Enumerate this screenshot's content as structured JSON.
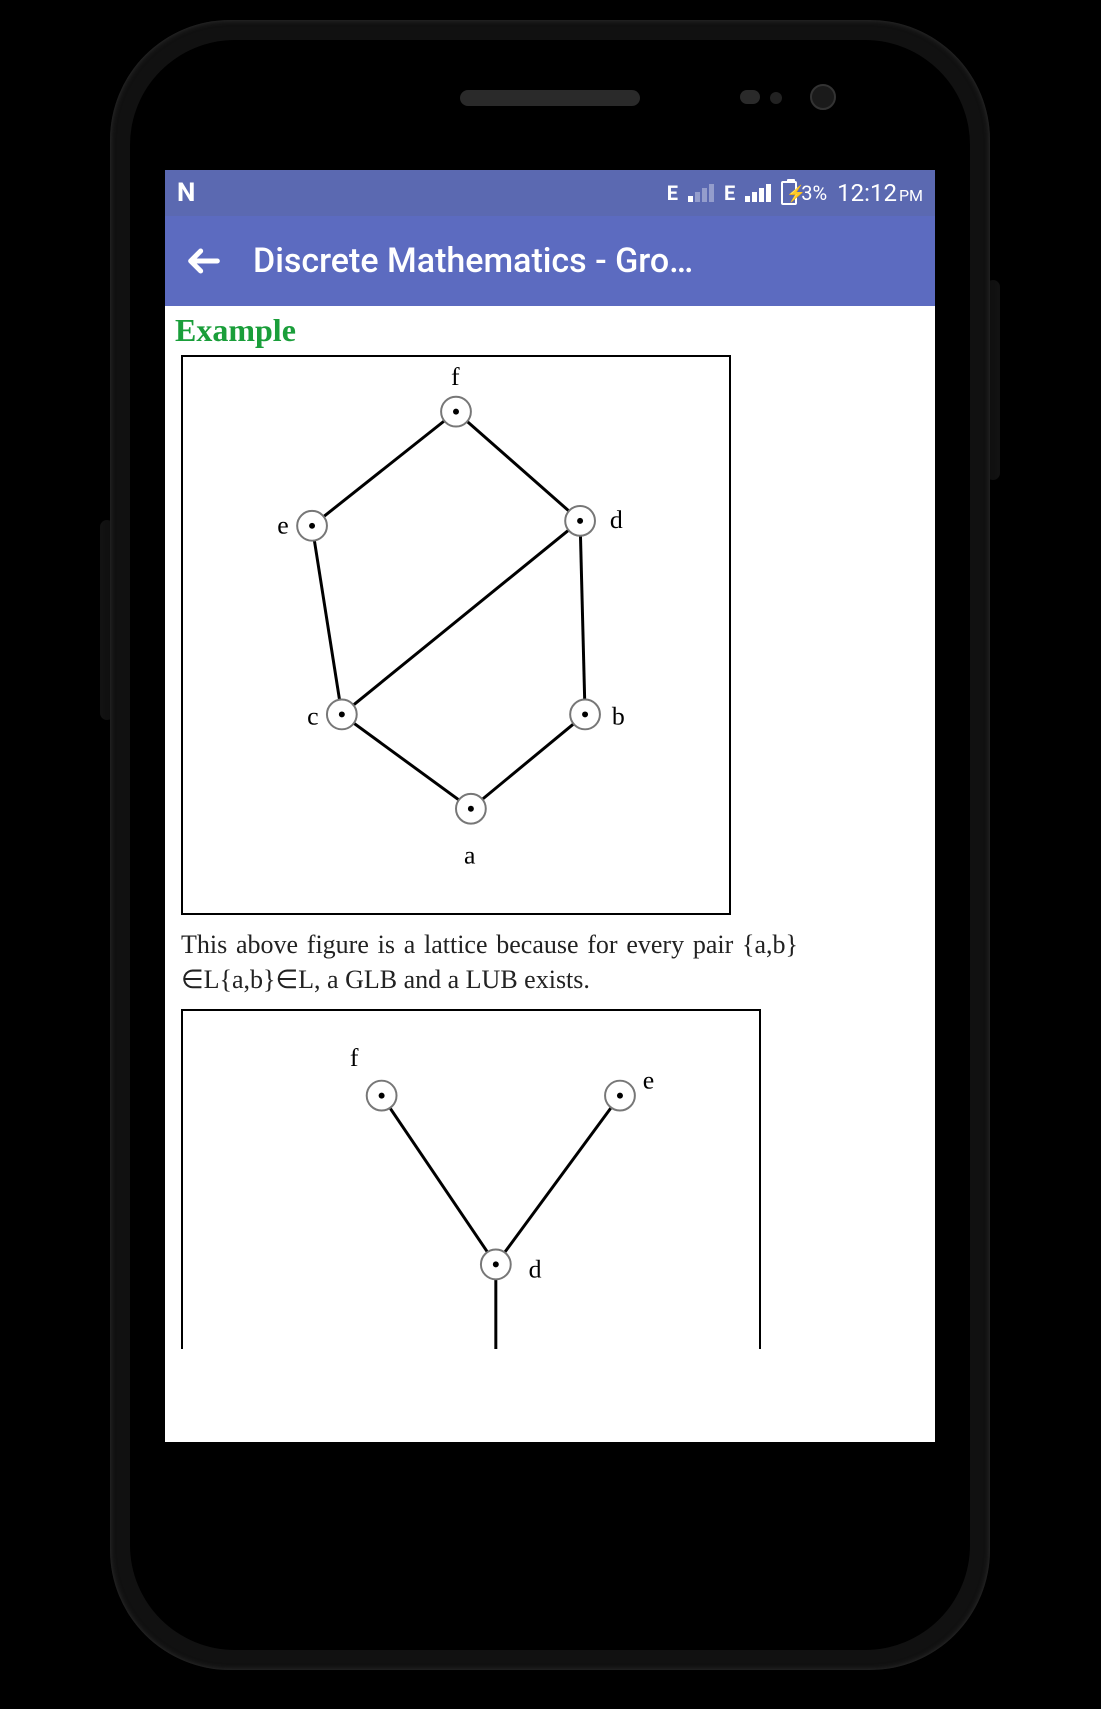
{
  "status": {
    "carrier_icon": "N",
    "net1_label": "E",
    "net2_label": "E",
    "battery_pct": "3%",
    "time": "12:12",
    "ampm": "PM"
  },
  "appbar": {
    "title": "Discrete Mathematics - Gro…"
  },
  "content": {
    "heading": "Example",
    "paragraph": "This above figure is a lattice because for every pair {a,b}∈L{a,b}∈L, a GLB and a LUB exists."
  },
  "fig1": {
    "labels": {
      "a": "a",
      "b": "b",
      "c": "c",
      "d": "d",
      "e": "e",
      "f": "f"
    }
  },
  "fig2": {
    "labels": {
      "d": "d",
      "e": "e",
      "f": "f"
    }
  }
}
